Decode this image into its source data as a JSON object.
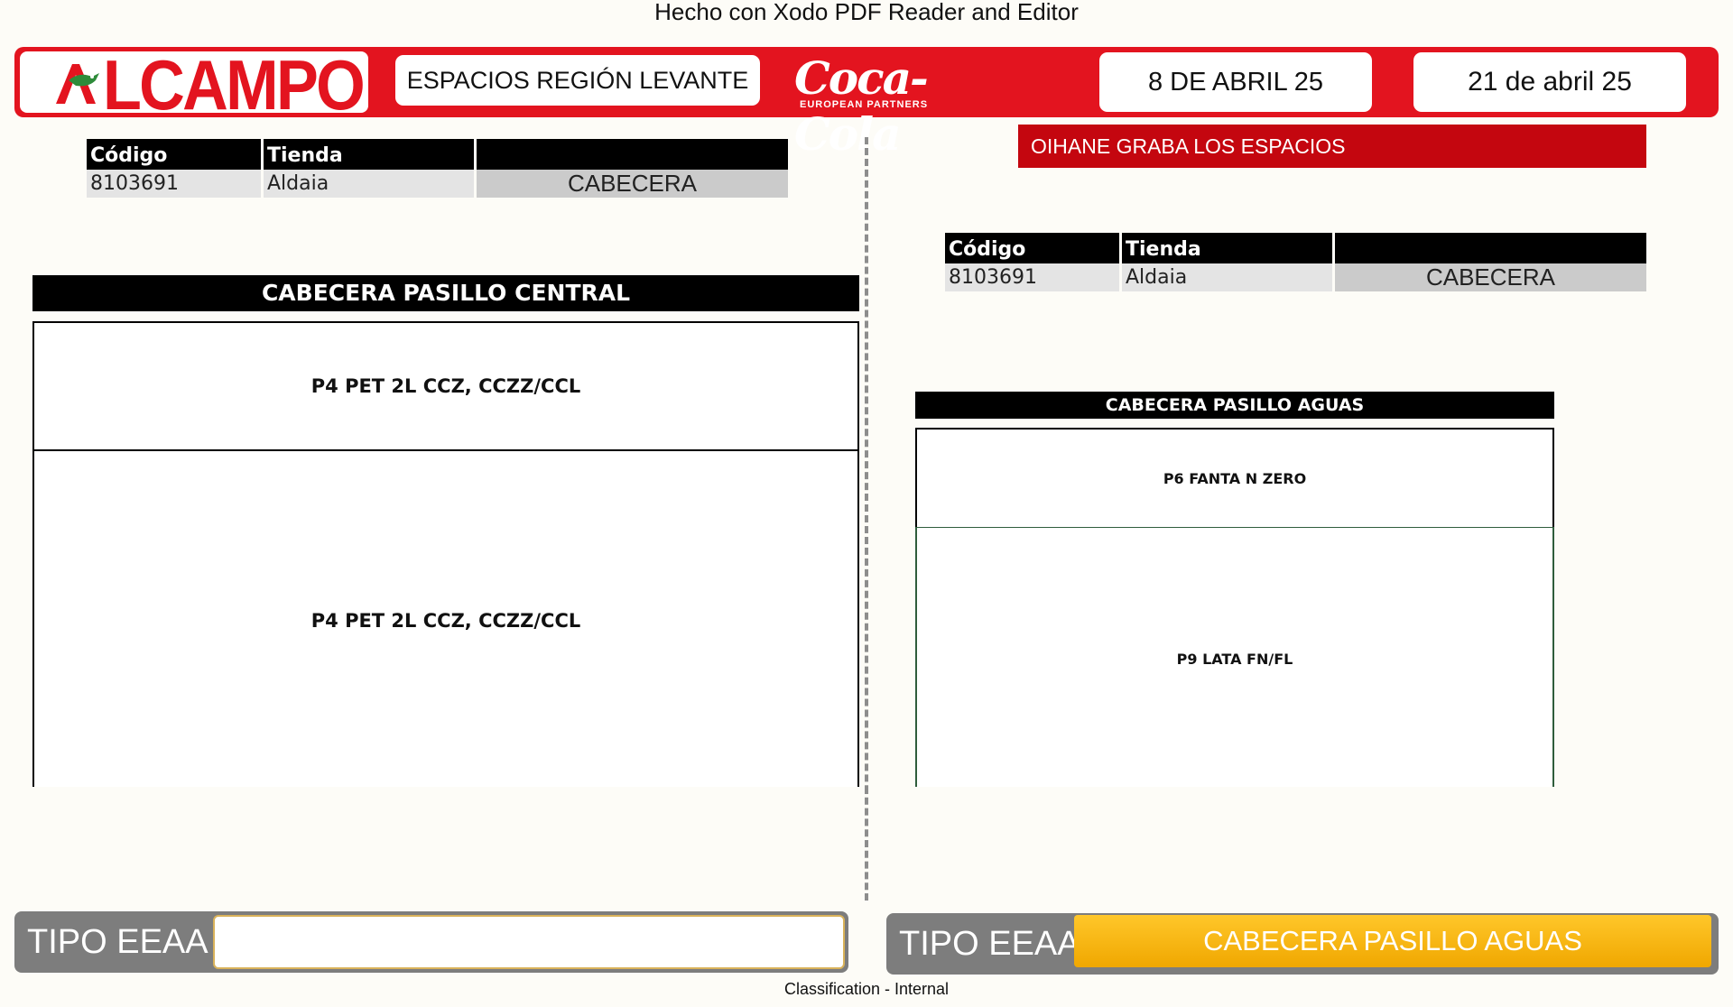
{
  "watermark": "Hecho con Xodo PDF Reader and Editor",
  "header": {
    "logo_text": "LCAMPO",
    "region": "ESPACIOS REGIÓN LEVANTE",
    "coke_logo": "Coca-Cola",
    "coke_sub": "EUROPEAN PARTNERS",
    "date_start": "8 DE ABRIL  25",
    "date_end": "21 de abril  25"
  },
  "notice": "OIHANE GRABA LOS ESPACIOS",
  "info_table": {
    "col_code": "Código",
    "col_store": "Tienda",
    "code": "8103691",
    "store": "Aldaia",
    "type": "CABECERA"
  },
  "left_section": {
    "title": "CABECERA PASILLO CENTRAL",
    "slot1": "P4 PET 2L CCZ, CCZZ/CCL",
    "slot2": "P4 PET 2L CCZ, CCZZ/CCL"
  },
  "right_section": {
    "title": "CABECERA PASILLO AGUAS",
    "slot1": "P6 FANTA N ZERO",
    "slot2": "P9 LATA FN/FL"
  },
  "footer": {
    "tipo_label": "TIPO EEAA",
    "tipo_left_value": "",
    "tipo_right_value": "CABECERA PASILLO AGUAS",
    "classification": "Classification - Internal"
  },
  "colors": {
    "brand_red": "#e3141f",
    "notice_red": "#c4060f",
    "tipo_gray": "#7d7d7d",
    "tipo_yellow": "#f5b400"
  }
}
